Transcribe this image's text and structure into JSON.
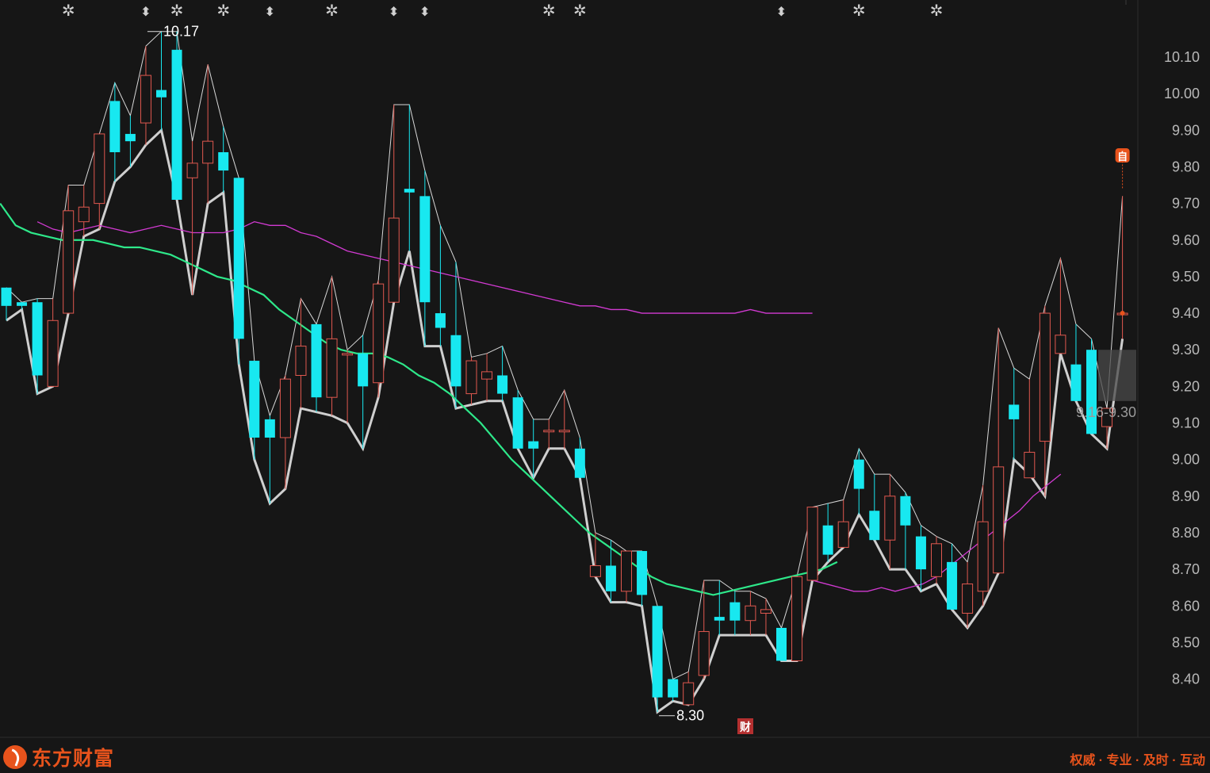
{
  "brand": {
    "name": "东方财富",
    "slogan": "权威 · 专业 · 及时 · 互动",
    "logo_icon": "eastmoney-logo-icon"
  },
  "colors": {
    "background": "#161616",
    "up": "#e0584f",
    "down": "#18e8f0",
    "ma_green": "#2ee88a",
    "ma_purple": "#d23ad2",
    "line_white": "#cfcfcf",
    "axis_text": "#b8b8b8",
    "accent": "#e8531c"
  },
  "chart_data": {
    "type": "candlestick",
    "y_ticks": [
      "10.10",
      "10.00",
      "9.90",
      "9.80",
      "9.70",
      "9.60",
      "9.50",
      "9.40",
      "9.30",
      "9.20",
      "9.10",
      "9.00",
      "8.90",
      "8.80",
      "8.70",
      "8.60",
      "8.50",
      "8.40"
    ],
    "ylim": [
      8.3,
      10.22
    ],
    "annotations": {
      "high_label": "10.17",
      "low_label": "8.30",
      "range_label": "9.16-9.30",
      "self_select_badge": "自",
      "finance_badge": "财"
    },
    "top_markers": [
      {
        "kind": "asterisk",
        "at": 4
      },
      {
        "kind": "arrow",
        "at": 9
      },
      {
        "kind": "asterisk",
        "at": 11
      },
      {
        "kind": "asterisk",
        "at": 14
      },
      {
        "kind": "arrow",
        "at": 17
      },
      {
        "kind": "asterisk",
        "at": 21
      },
      {
        "kind": "arrow",
        "at": 25
      },
      {
        "kind": "arrow",
        "at": 27
      },
      {
        "kind": "asterisk",
        "at": 35
      },
      {
        "kind": "asterisk",
        "at": 37
      },
      {
        "kind": "arrow",
        "at": 50
      },
      {
        "kind": "asterisk",
        "at": 55
      },
      {
        "kind": "asterisk",
        "at": 60
      }
    ],
    "candles": [
      [
        9.47,
        9.42,
        9.47,
        9.38
      ],
      [
        9.43,
        9.42,
        9.43,
        9.41
      ],
      [
        9.43,
        9.23,
        9.44,
        9.18
      ],
      [
        9.2,
        9.38,
        9.44,
        9.2
      ],
      [
        9.4,
        9.68,
        9.75,
        9.4
      ],
      [
        9.65,
        9.69,
        9.75,
        9.61
      ],
      [
        9.7,
        9.89,
        9.89,
        9.63
      ],
      [
        9.98,
        9.84,
        10.03,
        9.76
      ],
      [
        9.89,
        9.87,
        9.94,
        9.8
      ],
      [
        9.92,
        10.05,
        10.13,
        9.86
      ],
      [
        10.01,
        9.99,
        10.17,
        9.9
      ],
      [
        10.12,
        9.71,
        10.17,
        9.71
      ],
      [
        9.77,
        9.81,
        9.87,
        9.45
      ],
      [
        9.81,
        9.87,
        10.08,
        9.7
      ],
      [
        9.84,
        9.79,
        9.91,
        9.73
      ],
      [
        9.77,
        9.33,
        9.77,
        9.26
      ],
      [
        9.27,
        9.06,
        9.27,
        9.0
      ],
      [
        9.11,
        9.06,
        9.12,
        8.88
      ],
      [
        9.06,
        9.22,
        9.23,
        8.92
      ],
      [
        9.23,
        9.31,
        9.44,
        9.14
      ],
      [
        9.37,
        9.17,
        9.37,
        9.13
      ],
      [
        9.17,
        9.33,
        9.5,
        9.12
      ],
      [
        9.29,
        9.29,
        9.3,
        9.1
      ],
      [
        9.29,
        9.2,
        9.34,
        9.03
      ],
      [
        9.21,
        9.48,
        9.49,
        9.17
      ],
      [
        9.43,
        9.66,
        9.97,
        9.43
      ],
      [
        9.74,
        9.73,
        9.97,
        9.57
      ],
      [
        9.72,
        9.43,
        9.79,
        9.31
      ],
      [
        9.4,
        9.36,
        9.64,
        9.31
      ],
      [
        9.34,
        9.2,
        9.54,
        9.14
      ],
      [
        9.18,
        9.27,
        9.28,
        9.15
      ],
      [
        9.22,
        9.24,
        9.29,
        9.16
      ],
      [
        9.23,
        9.18,
        9.31,
        9.16
      ],
      [
        9.17,
        9.03,
        9.19,
        9.03
      ],
      [
        9.05,
        9.03,
        9.11,
        8.95
      ],
      [
        9.08,
        9.08,
        9.11,
        9.03
      ],
      [
        9.08,
        9.08,
        9.19,
        9.03
      ],
      [
        9.03,
        8.95,
        9.06,
        8.95
      ],
      [
        8.68,
        8.71,
        8.8,
        8.68
      ],
      [
        8.71,
        8.64,
        8.78,
        8.61
      ],
      [
        8.64,
        8.75,
        8.75,
        8.61
      ],
      [
        8.75,
        8.63,
        8.75,
        8.6
      ],
      [
        8.6,
        8.35,
        8.6,
        8.31
      ],
      [
        8.4,
        8.35,
        8.4,
        8.34
      ],
      [
        8.33,
        8.39,
        8.42,
        8.33
      ],
      [
        8.41,
        8.53,
        8.67,
        8.4
      ],
      [
        8.57,
        8.56,
        8.67,
        8.52
      ],
      [
        8.61,
        8.56,
        8.64,
        8.52
      ],
      [
        8.56,
        8.6,
        8.64,
        8.52
      ],
      [
        8.58,
        8.59,
        8.62,
        8.52
      ],
      [
        8.54,
        8.45,
        8.54,
        8.45
      ],
      [
        8.45,
        8.68,
        8.68,
        8.45
      ],
      [
        8.67,
        8.87,
        8.87,
        8.67
      ],
      [
        8.82,
        8.74,
        8.88,
        8.72
      ],
      [
        8.76,
        8.83,
        8.89,
        8.76
      ],
      [
        9.0,
        8.92,
        9.03,
        8.85
      ],
      [
        8.86,
        8.78,
        8.96,
        8.78
      ],
      [
        8.78,
        8.9,
        8.96,
        8.7
      ],
      [
        8.9,
        8.82,
        8.91,
        8.7
      ],
      [
        8.79,
        8.7,
        8.82,
        8.64
      ],
      [
        8.68,
        8.77,
        8.79,
        8.66
      ],
      [
        8.72,
        8.59,
        8.77,
        8.59
      ],
      [
        8.58,
        8.66,
        8.72,
        8.54
      ],
      [
        8.64,
        8.83,
        8.93,
        8.6
      ],
      [
        8.69,
        8.98,
        9.36,
        8.69
      ],
      [
        9.15,
        9.11,
        9.25,
        9.0
      ],
      [
        8.95,
        9.02,
        9.22,
        8.96
      ],
      [
        9.05,
        9.4,
        9.42,
        8.9
      ],
      [
        9.29,
        9.34,
        9.55,
        9.29
      ],
      [
        9.26,
        9.16,
        9.37,
        9.16
      ],
      [
        9.3,
        9.07,
        9.33,
        9.07
      ],
      [
        9.09,
        9.14,
        9.14,
        9.03
      ],
      [
        9.4,
        9.4,
        9.72,
        9.33
      ]
    ],
    "ma_green": [
      9.7,
      9.64,
      9.62,
      9.61,
      9.6,
      9.6,
      9.6,
      9.59,
      9.58,
      9.58,
      9.57,
      9.56,
      9.54,
      9.52,
      9.5,
      9.49,
      9.47,
      9.45,
      9.41,
      9.38,
      9.35,
      9.32,
      9.3,
      9.29,
      9.29,
      9.28,
      9.26,
      9.23,
      9.21,
      9.18,
      9.14,
      9.1,
      9.05,
      9.0,
      8.96,
      8.92,
      8.88,
      8.84,
      8.8,
      8.77,
      8.74,
      8.71,
      8.68,
      8.66,
      8.65,
      8.64,
      8.63,
      8.64,
      8.65,
      8.66,
      8.67,
      8.68,
      8.69,
      8.7,
      8.72
    ],
    "ma_purple_start": 2,
    "ma_purple": [
      9.65,
      9.63,
      9.62,
      9.63,
      9.64,
      9.63,
      9.62,
      9.63,
      9.64,
      9.63,
      9.62,
      9.62,
      9.62,
      9.63,
      9.65,
      9.64,
      9.64,
      9.62,
      9.61,
      9.59,
      9.57,
      9.56,
      9.55,
      9.54,
      9.53,
      9.52,
      9.51,
      9.5,
      9.49,
      9.48,
      9.47,
      9.46,
      9.45,
      9.44,
      9.43,
      9.42,
      9.42,
      9.41,
      9.41,
      9.4,
      9.4,
      9.4,
      9.4,
      9.4,
      9.4,
      9.4,
      9.41,
      9.4,
      9.4,
      9.4,
      9.4,
      9.4,
      8.67,
      8.66,
      8.65,
      8.64,
      8.64,
      8.65,
      8.64,
      8.65,
      8.66,
      8.68,
      8.71,
      8.74,
      8.77,
      8.8,
      8.83,
      8.86,
      8.9,
      8.93,
      8.96
    ],
    "last_price": 9.4,
    "range_box": [
      9.16,
      9.3
    ]
  }
}
